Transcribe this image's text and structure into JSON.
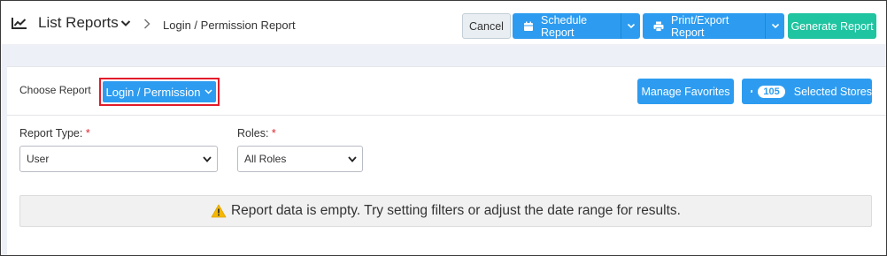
{
  "header": {
    "title": "List Reports",
    "breadcrumb": "Login / Permission Report",
    "icons": {
      "title": "line-chart-icon",
      "dropdown": "chevron-down-icon",
      "separator": "chevron-right-icon"
    }
  },
  "toolbar": {
    "cancel_label": "Cancel",
    "schedule_label": "Schedule Report",
    "print_label": "Print/Export Report",
    "generate_label": "Generate Report"
  },
  "report_selector": {
    "label": "Choose Report",
    "selected": "Login / Permission",
    "manage_favorites_label": "Manage Favorites",
    "stores_count": "105",
    "stores_label": "Selected Stores"
  },
  "filters": {
    "report_type": {
      "label": "Report Type:",
      "required_mark": "*",
      "value": "User"
    },
    "roles": {
      "label": "Roles:",
      "required_mark": "*",
      "value": "All Roles"
    }
  },
  "message": {
    "text": "Report data is empty. Try setting filters or adjust the date range for results.",
    "icon": "warning-icon"
  },
  "colors": {
    "primary": "#2d9cf0",
    "success": "#1fc4a0",
    "highlight": "#e21b2a",
    "warning": "#f5b700"
  }
}
